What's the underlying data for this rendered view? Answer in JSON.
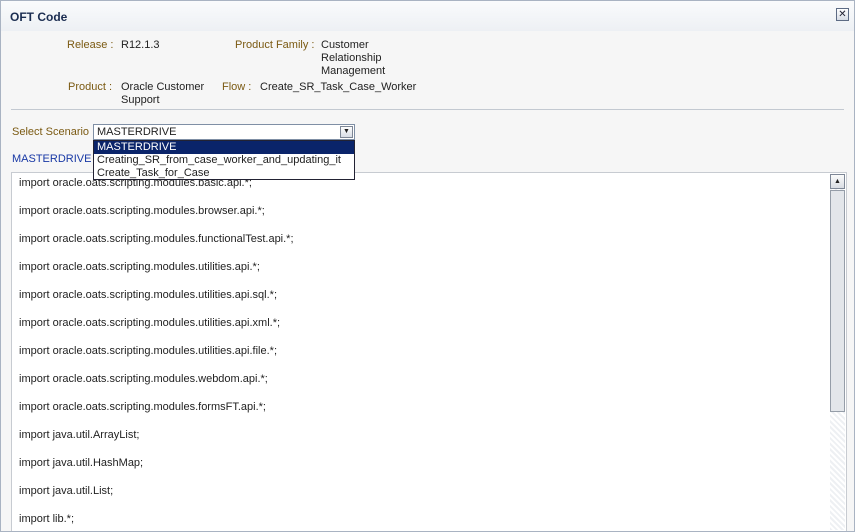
{
  "dialog": {
    "title": "OFT Code",
    "close_glyph": "✕"
  },
  "info": {
    "release_label": "Release :",
    "release_value": "R12.1.3",
    "product_family_label": "Product Family :",
    "product_family_lines": [
      "Customer",
      "Relationship",
      "Management"
    ],
    "product_label": "Product :",
    "product_lines": [
      "Oracle Customer",
      "Support"
    ],
    "flow_label": "Flow :",
    "flow_value": "Create_SR_Task_Case_Worker"
  },
  "scenario": {
    "label": "Select Scenario",
    "selected": "MASTERDRIVE",
    "options": [
      "MASTERDRIVE",
      "Creating_SR_from_case_worker_and_updating_it",
      "Create_Task_for_Case"
    ]
  },
  "current_link": "MASTERDRIVE",
  "code_lines": [
    "import oracle.oats.scripting.modules.basic.api.*;",
    "import oracle.oats.scripting.modules.browser.api.*;",
    "import oracle.oats.scripting.modules.functionalTest.api.*;",
    "import oracle.oats.scripting.modules.utilities.api.*;",
    "import oracle.oats.scripting.modules.utilities.api.sql.*;",
    "import oracle.oats.scripting.modules.utilities.api.xml.*;",
    "import oracle.oats.scripting.modules.utilities.api.file.*;",
    "import oracle.oats.scripting.modules.webdom.api.*;",
    "import oracle.oats.scripting.modules.formsFT.api.*;",
    "import java.util.ArrayList;",
    "import java.util.HashMap;",
    "import java.util.List;",
    "import lib.*;"
  ]
}
